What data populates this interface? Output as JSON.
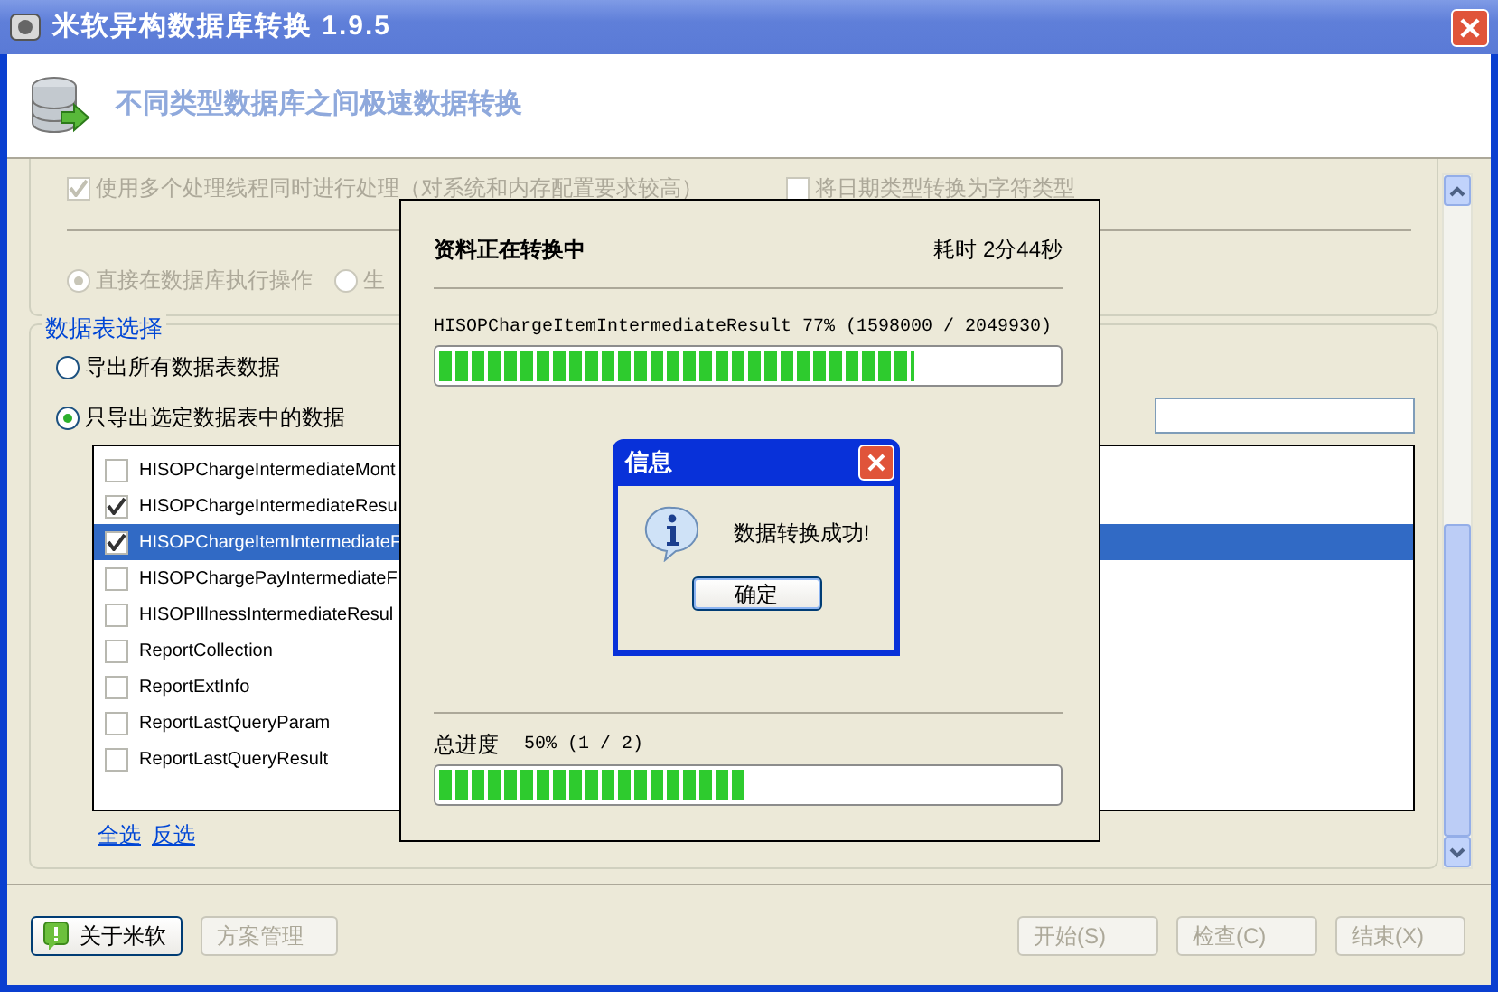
{
  "window": {
    "title": "米软异构数据库转换 1.9.5"
  },
  "header": {
    "subtitle": "不同类型数据库之间极速数据转换"
  },
  "options": [
    {
      "label": "使用多个处理线程同时进行处理（对系统和内存配置要求较高）",
      "checked": true,
      "disabled": true
    },
    {
      "label": "将日期类型转换为字符类型",
      "checked": false,
      "disabled": true
    }
  ],
  "mode_radios": [
    {
      "label": "直接在数据库执行操作",
      "selected": true,
      "disabled": true
    },
    {
      "label": "生",
      "selected": false,
      "disabled": true
    }
  ],
  "table_selection": {
    "title": "数据表选择",
    "radios": [
      {
        "label": "导出所有数据表数据",
        "selected": false
      },
      {
        "label": "只导出选定数据表中的数据",
        "selected": true
      }
    ],
    "tables": [
      {
        "name": "HISOPChargeIntermediateMont",
        "checked": false,
        "selected": false
      },
      {
        "name": "HISOPChargeIntermediateResu",
        "checked": true,
        "selected": false
      },
      {
        "name": "HISOPChargeItemIntermediateF",
        "checked": true,
        "selected": true
      },
      {
        "name": "HISOPChargePayIntermediateF",
        "checked": false,
        "selected": false
      },
      {
        "name": "HISOPIllnessIntermediateResul",
        "checked": false,
        "selected": false
      },
      {
        "name": "ReportCollection",
        "checked": false,
        "selected": false
      },
      {
        "name": "ReportExtInfo",
        "checked": false,
        "selected": false
      },
      {
        "name": "ReportLastQueryParam",
        "checked": false,
        "selected": false
      },
      {
        "name": "ReportLastQueryResult",
        "checked": false,
        "selected": false
      }
    ],
    "links": [
      "全选",
      "反选"
    ]
  },
  "footer_buttons": [
    {
      "label": "关于米软",
      "disabled": false,
      "kind": "about"
    },
    {
      "label": "方案管理",
      "disabled": true,
      "kind": "plain"
    },
    {
      "label": "开始(S)",
      "disabled": true,
      "kind": "plain"
    },
    {
      "label": "检查(C)",
      "disabled": true,
      "kind": "plain"
    },
    {
      "label": "结束(X)",
      "disabled": true,
      "kind": "plain"
    }
  ],
  "progress_dialog": {
    "title": "资料正在转换中",
    "elapsed": "耗时 2分44秒",
    "current": {
      "text": "HISOPChargeItemIntermediateResult 77% (1598000 / 2049930)",
      "level": 0.77
    },
    "total": {
      "label": "总进度",
      "text": "50% (1 / 2)",
      "level": 0.5
    }
  },
  "message_box": {
    "title": "信息",
    "message": "数据转换成功!",
    "button": "确定"
  }
}
